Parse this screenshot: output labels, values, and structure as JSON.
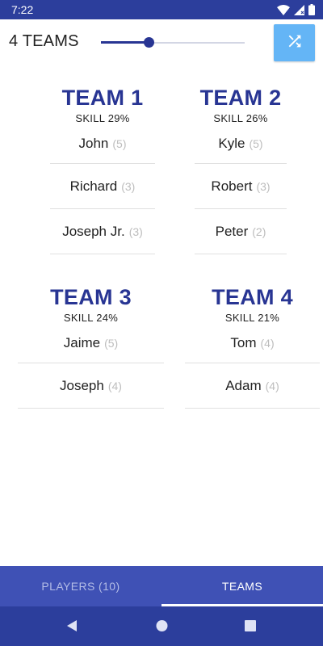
{
  "status_bar": {
    "time": "7:22",
    "icons": [
      "wifi-icon",
      "signal-icon",
      "battery-icon"
    ]
  },
  "header": {
    "team_count_label": "4 TEAMS",
    "slider_level": 0.33,
    "shuffle_icon": "shuffle-icon"
  },
  "teams": [
    {
      "title": "TEAM 1",
      "skill": "SKILL 29%",
      "players": [
        {
          "name": "John",
          "skill": "(5)"
        },
        {
          "name": "Richard",
          "skill": "(3)"
        },
        {
          "name": "Joseph Jr.",
          "skill": "(3)"
        }
      ]
    },
    {
      "title": "TEAM 2",
      "skill": "SKILL 26%",
      "players": [
        {
          "name": "Kyle",
          "skill": "(5)"
        },
        {
          "name": "Robert",
          "skill": "(3)"
        },
        {
          "name": "Peter",
          "skill": "(2)"
        }
      ]
    },
    {
      "title": "TEAM 3",
      "skill": "SKILL 24%",
      "players": [
        {
          "name": "Jaime",
          "skill": "(5)"
        },
        {
          "name": "Joseph",
          "skill": "(4)"
        }
      ]
    },
    {
      "title": "TEAM 4",
      "skill": "SKILL 21%",
      "players": [
        {
          "name": "Tom",
          "skill": "(4)"
        },
        {
          "name": "Adam",
          "skill": "(4)"
        }
      ]
    }
  ],
  "tabs": [
    {
      "label": "PLAYERS (10)",
      "active": false
    },
    {
      "label": "TEAMS",
      "active": true
    }
  ],
  "nav": {
    "back_icon": "back-icon",
    "home_icon": "home-icon",
    "recents_icon": "recents-icon"
  },
  "colors": {
    "primary_dark": "#2c3e9c",
    "primary": "#3f51b5",
    "team_title": "#283593",
    "shuffle_button": "#64b5f6"
  }
}
